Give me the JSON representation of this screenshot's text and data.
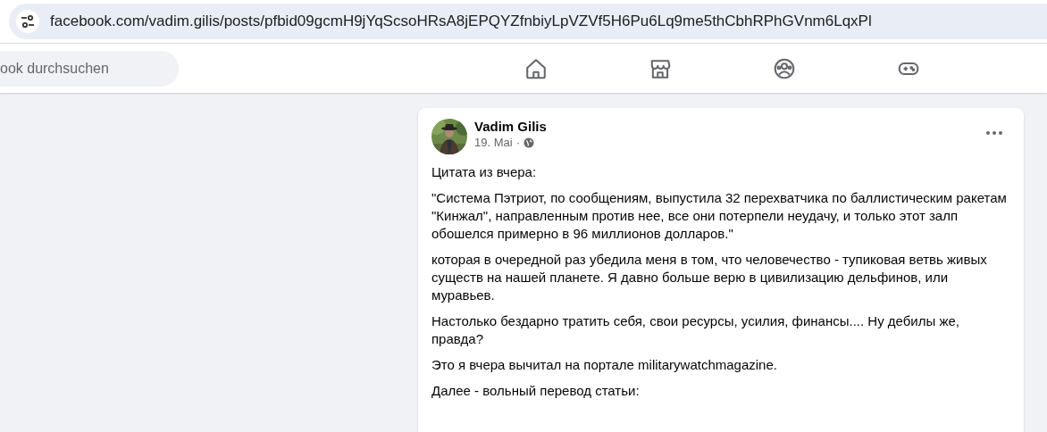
{
  "address_bar": {
    "url": "facebook.com/vadim.gilis/posts/pfbid09gcmH9jYqScsoHRsA8jEPQYZfnbiyLpVZVf5H6Pu6Lq9me5thCbhRPhGVnm6LqxPl"
  },
  "top_bar": {
    "search": {
      "placeholder": "ook durchsuchen"
    },
    "nav": [
      {
        "kind": "home"
      },
      {
        "kind": "marketplace"
      },
      {
        "kind": "groups"
      },
      {
        "kind": "gaming"
      }
    ]
  },
  "post": {
    "author": "Vadim Gilis",
    "date": "19. Mai",
    "separator": "·",
    "paragraphs": [
      "Цитата из вчера:",
      "\"Система Пэтриот, по сообщениям, выпустила 32 перехватчика по баллистическим ракетам \"Кинжал\", направленным против нее, все они потерпели неудачу, и только этот залп обошелся примерно в 96 миллионов долларов.\"",
      "которая в очередной раз убедила меня в том, что человечество - тупиковая ветвь живых существ на нашей планете. Я давно больше верю в цивилизацию дельфинов, или муравьев.",
      "Настолько бездарно тратить себя, свои ресурсы, усилия, финансы.... Ну дебилы же, правда?",
      "Это я вчера вычитал на портале militarywatchmagazine.",
      "Далее - вольный перевод статьи:"
    ]
  }
}
